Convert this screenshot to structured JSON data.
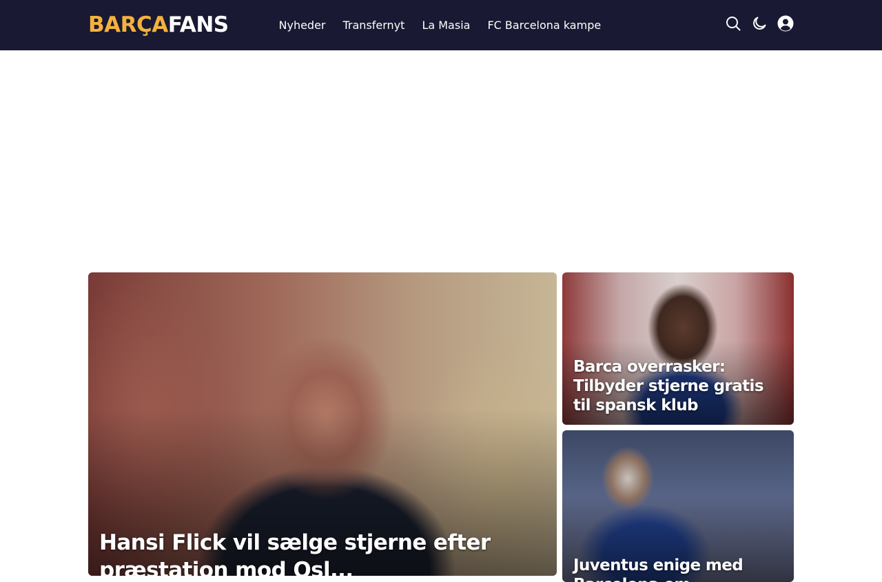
{
  "header": {
    "logo": {
      "part1": "BARÇA",
      "part2": "FANS"
    },
    "nav": [
      {
        "label": "Nyheder"
      },
      {
        "label": "Transfernyt"
      },
      {
        "label": "La Masia"
      },
      {
        "label": "FC Barcelona kampe"
      }
    ],
    "icons": [
      "search-icon",
      "dark-mode-icon",
      "user-account-icon"
    ]
  },
  "articles": {
    "main": {
      "title": "Hansi Flick vil sælge stjerne efter præstation mod Osl..."
    },
    "side_top": {
      "title": "Barca overrasker: Tilbyder stjerne gratis til spansk klub"
    },
    "side_bottom": {
      "title": "Juventus enige med Barcelona om..."
    }
  },
  "colors": {
    "header_bg": "#191933",
    "logo_accent": "#f4b23d",
    "text": "#ffffff"
  }
}
